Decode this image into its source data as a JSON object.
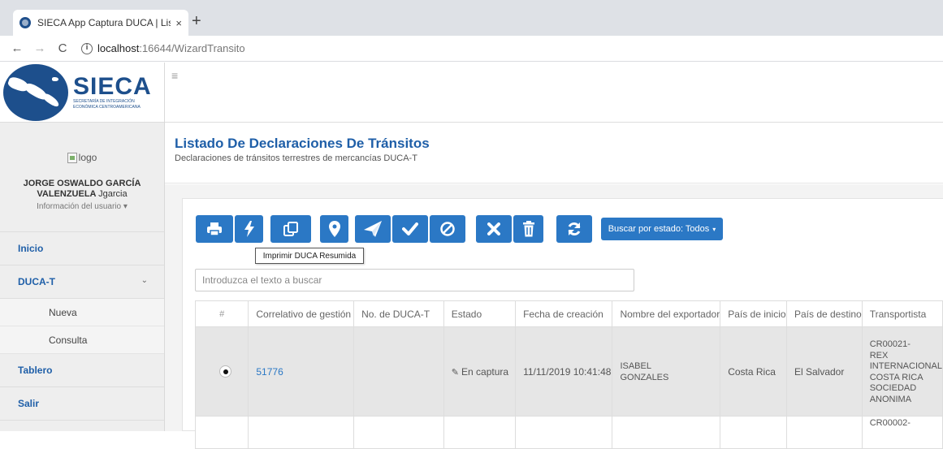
{
  "browser": {
    "tab_title": "SIECA App Captura DUCA | Listac",
    "tab_close": "×",
    "new_tab": "+",
    "back": "←",
    "forward": "→",
    "reload": "C",
    "info": "i",
    "url_host": "localhost",
    "url_path": ":16644/WizardTransito"
  },
  "brand": {
    "name": "SIECA",
    "subtitle_line1": "SECRETARÍA DE INTEGRACIÓN",
    "subtitle_line2": "ECONÓMICA CENTROAMERICANA",
    "color": "#1d4f8c"
  },
  "user": {
    "logo_alt": "logo",
    "full_name": "JORGE OSWALDO GARCÍA",
    "last_name": "VALENZUELA",
    "login": "Jgarcia",
    "info_label": "Información del usuario ▾"
  },
  "menu": {
    "inicio": "Inicio",
    "duca_t": "DUCA-T",
    "duca_chevron": "⌄",
    "nueva": "Nueva",
    "consulta": "Consulta",
    "tablero": "Tablero",
    "salir": "Salir"
  },
  "topbar": {
    "hamburger": "≡"
  },
  "page": {
    "title": "Listado De Declaraciones De Tránsitos",
    "subtitle": "Declaraciones de tránsitos terrestres de mercancías DUCA-T"
  },
  "toolbar": {
    "accent": "#2b78c5",
    "buttons": [
      "print-icon",
      "bolt-icon",
      "copy-icon",
      "map-marker-icon",
      "send-icon",
      "check-icon",
      "ban-icon",
      "times-icon",
      "trash-icon",
      "refresh-icon"
    ],
    "estado_label": "Buscar por estado: Todos",
    "estado_caret": "▾",
    "tooltip": "Imprimir DUCA Resumida"
  },
  "search": {
    "placeholder": "Introduzca el texto a buscar"
  },
  "table": {
    "headers": [
      "#",
      "Correlativo de gestión",
      "No. de DUCA-T",
      "Estado",
      "Fecha de creación",
      "Nombre del exportador",
      "País de inicio",
      "País de destino",
      "Transportista"
    ],
    "rows": [
      {
        "correlativo": "51776",
        "no_duca": "",
        "estado_icon": "✎",
        "estado": "En captura",
        "fecha": "11/11/2019 10:41:48",
        "nombre": "ISABEL\nGONZALES",
        "pais_inicio": "Costa Rica",
        "pais_destino": "El Salvador",
        "transportista": "CR00021-\nREX\nINTERNACIONAL\nCOSTA RICA\nSOCIEDAD\nANONIMA"
      },
      {
        "transportista": "CR00002-"
      }
    ]
  }
}
